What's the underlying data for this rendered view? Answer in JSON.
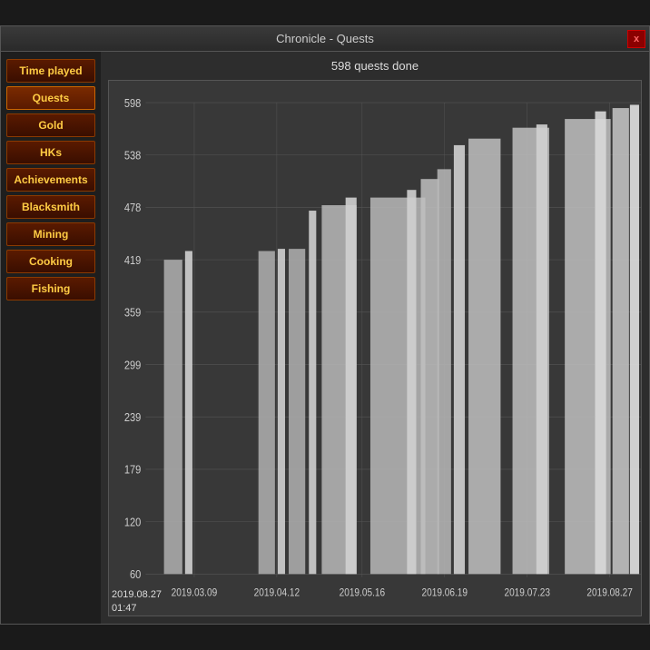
{
  "window": {
    "title": "Chronicle - Quests",
    "close_label": "x"
  },
  "chart": {
    "subtitle": "598 quests done",
    "datetime": "2019.08.27\n01:47",
    "y_labels": [
      "598",
      "538",
      "478",
      "419",
      "359",
      "299",
      "239",
      "179",
      "120",
      "60"
    ],
    "x_labels": [
      "2019.03.09",
      "2019.04.12",
      "2019.05.16",
      "2019.06.19",
      "2019.07.23",
      "2019.08.27"
    ]
  },
  "sidebar": {
    "buttons": [
      {
        "label": "Time played",
        "active": false
      },
      {
        "label": "Quests",
        "active": true
      },
      {
        "label": "Gold",
        "active": false
      },
      {
        "label": "HKs",
        "active": false
      },
      {
        "label": "Achievements",
        "active": false
      },
      {
        "label": "Blacksmith",
        "active": false
      },
      {
        "label": "Mining",
        "active": false
      },
      {
        "label": "Cooking",
        "active": false
      },
      {
        "label": "Fishing",
        "active": false
      }
    ]
  }
}
